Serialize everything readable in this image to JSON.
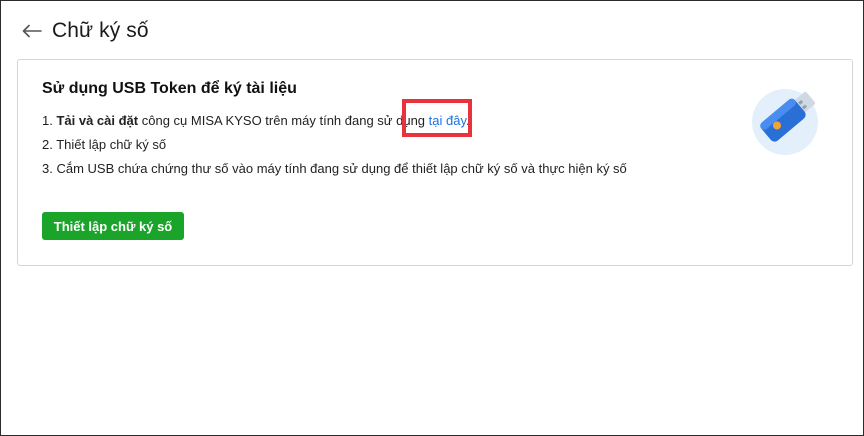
{
  "header": {
    "back_icon": "arrow-left-icon",
    "title": "Chữ ký số"
  },
  "card": {
    "title": "Sử dụng USB Token để ký tài liệu",
    "step1": {
      "prefix": "1. ",
      "bold": "Tải và cài đặt",
      "text": " công cụ MISA KYSO trên máy tính đang sử dụng ",
      "link": "tại đây",
      "suffix": "."
    },
    "step2": "2. Thiết lập chữ ký số",
    "step3": "3. Cắm USB chứa chứng thư số vào máy tính đang sử dụng để thiết lập chữ ký số và thực hiện ký số",
    "button_label": "Thiết lập chữ ký số",
    "illustration_icon": "usb-token-icon"
  },
  "colors": {
    "primary_button": "#1aa52a",
    "link": "#1a73e8",
    "highlight": "#e8323c",
    "usb_circle": "#e3f0fc",
    "usb_body": "#2a6fd6"
  }
}
